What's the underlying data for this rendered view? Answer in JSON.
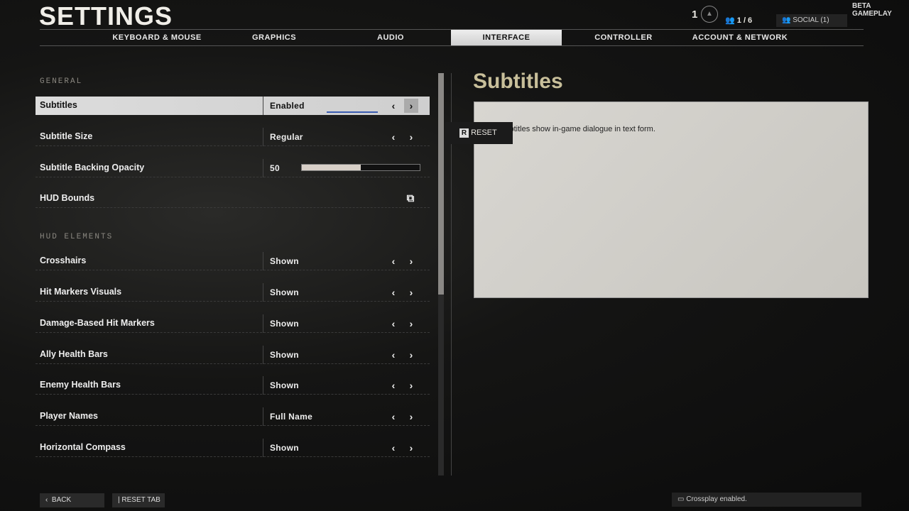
{
  "header": {
    "title": "SETTINGS",
    "level": "1",
    "party": "1 / 6",
    "social": "SOCIAL (1)",
    "build": "BETA GAMEPLAY"
  },
  "tabs": [
    {
      "label": "KEYBOARD & MOUSE"
    },
    {
      "label": "GRAPHICS"
    },
    {
      "label": "AUDIO"
    },
    {
      "label": "INTERFACE",
      "active": true
    },
    {
      "label": "CONTROLLER"
    },
    {
      "label": "ACCOUNT & NETWORK"
    }
  ],
  "sections": {
    "general": "GENERAL",
    "hud": "HUD ELEMENTS"
  },
  "general": [
    {
      "label": "Subtitles",
      "value": "Enabled"
    },
    {
      "label": "Subtitle Size",
      "value": "Regular"
    },
    {
      "label": "Subtitle Backing Opacity",
      "value": "50",
      "slider_percent": 50
    },
    {
      "label": "HUD Bounds",
      "icon": "external-link-icon"
    }
  ],
  "hud": [
    {
      "label": "Crosshairs",
      "value": "Shown"
    },
    {
      "label": "Hit Markers Visuals",
      "value": "Shown"
    },
    {
      "label": "Damage-Based Hit Markers",
      "value": "Shown"
    },
    {
      "label": "Ally Health Bars",
      "value": "Shown"
    },
    {
      "label": "Enemy Health Bars",
      "value": "Shown"
    },
    {
      "label": "Player Names",
      "value": "Full Name"
    },
    {
      "label": "Horizontal Compass",
      "value": "Shown"
    }
  ],
  "detail": {
    "title": "Subtitles",
    "description": "Subtitles show in-game dialogue in text form.",
    "reset_key": "R",
    "reset_label": "RESET"
  },
  "footer": {
    "back": "BACK",
    "reset_tab": "| RESET TAB",
    "crossplay": "Crossplay enabled."
  },
  "colors": {
    "accent": "#c8bf9a",
    "selected_bar": "#3a5cb0"
  }
}
